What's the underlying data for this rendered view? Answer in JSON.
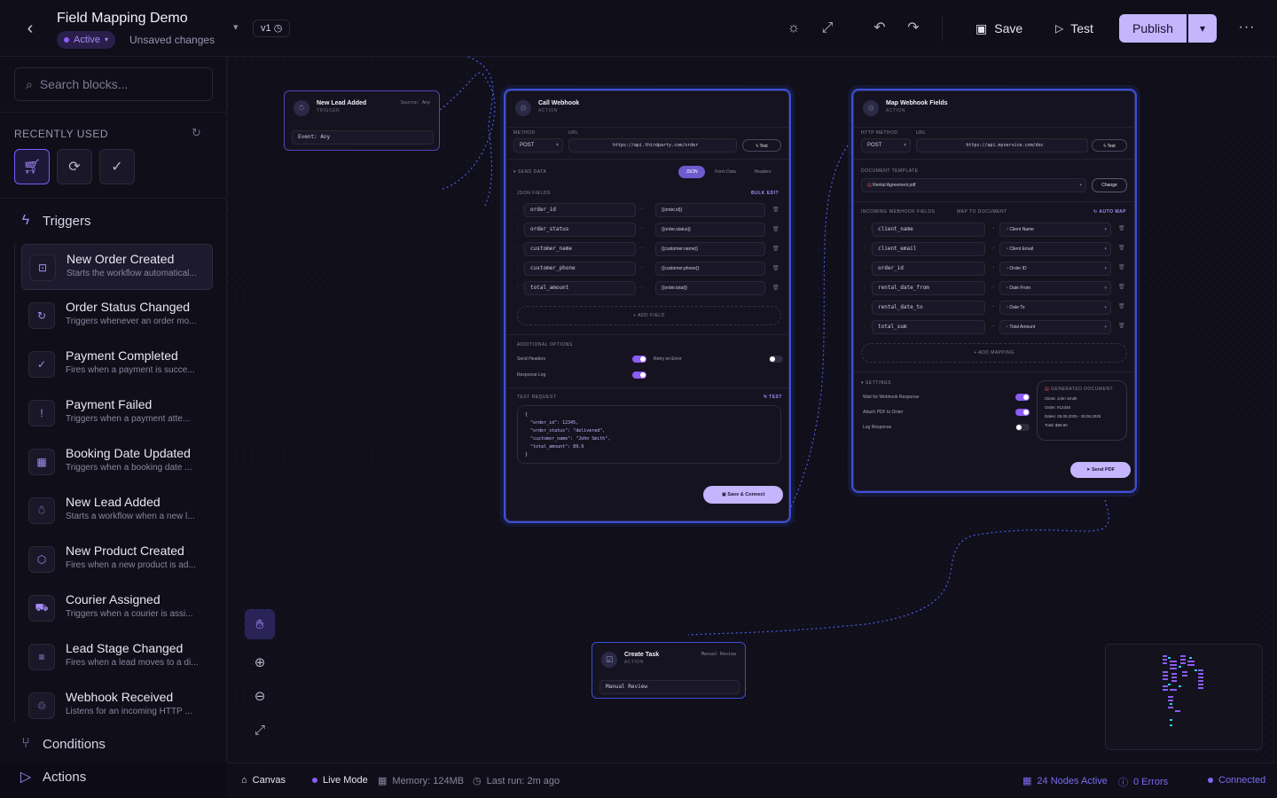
{
  "header": {
    "title": "Field Mapping Demo",
    "status": "Active",
    "unsaved": "Unsaved changes",
    "version": "v1",
    "save_label": "Save",
    "test_label": "Test",
    "publish_label": "Publish"
  },
  "sidebar": {
    "search_placeholder": "Search blocks...",
    "recently_used_title": "RECENTLY USED",
    "sections": {
      "triggers": "Triggers",
      "conditions": "Conditions",
      "actions": "Actions"
    },
    "triggers": [
      {
        "title": "New Order Created",
        "desc": "Starts the workflow automatical..."
      },
      {
        "title": "Order Status Changed",
        "desc": "Triggers whenever an order mo..."
      },
      {
        "title": "Payment Completed",
        "desc": "Fires when a payment is succe..."
      },
      {
        "title": "Payment Failed",
        "desc": "Triggers when a payment atte..."
      },
      {
        "title": "Booking Date Updated",
        "desc": "Triggers when a booking date ..."
      },
      {
        "title": "New Lead Added",
        "desc": "Starts a workflow when a new l..."
      },
      {
        "title": "New Product Created",
        "desc": "Fires when a new product is ad..."
      },
      {
        "title": "Courier Assigned",
        "desc": "Triggers when a courier is assi..."
      },
      {
        "title": "Lead Stage Changed",
        "desc": "Fires when a lead moves to a di..."
      },
      {
        "title": "Webhook Received",
        "desc": "Listens for an incoming HTTP ..."
      }
    ]
  },
  "nodes": {
    "lead": {
      "title": "New Lead Added",
      "type": "TRIGGER",
      "source": "Source: Any",
      "event": "Event: Any"
    },
    "webhook": {
      "title": "Call Webhook",
      "type": "ACTION",
      "method_label": "METHOD",
      "url_label": "URL",
      "method": "POST",
      "url": "https://api.thirdparty.com/order",
      "test": "Test",
      "send_data": "SEND DATA",
      "tabs": [
        "JSON",
        "Form Data",
        "Headers"
      ],
      "json_fields_label": "JSON FIELDS",
      "bulk_edit": "BULK EDIT",
      "fields": [
        {
          "key": "order_id",
          "value": "{{order.id}}"
        },
        {
          "key": "order_status",
          "value": "{{order.status}}"
        },
        {
          "key": "customer_name",
          "value": "{{customer.name}}"
        },
        {
          "key": "customer_phone",
          "value": "{{customer.phone}}"
        },
        {
          "key": "total_amount",
          "value": "{{order.total}}"
        }
      ],
      "add_field": "ADD FIELD",
      "additional_options": "ADDITIONAL OPTIONS",
      "send_headers": "Send Headers",
      "retry_on_error": "Retry on Error",
      "response_log": "Response Log",
      "test_request": "TEST REQUEST",
      "test_small": "TEST",
      "json_preview": [
        "{",
        "  \"order_id\": 12345,",
        "  \"order_status\": \"delivered\",",
        "  \"customer_name\": \"John Smith\",",
        "  \"total_amount\": 89.9",
        "}"
      ],
      "save_connect": "Save & Connect"
    },
    "map": {
      "title": "Map Webhook Fields",
      "type": "ACTION",
      "method_label": "HTTP METHOD",
      "url_label": "URL",
      "method": "POST",
      "url": "https://api.myservice.com/doc",
      "test": "Test",
      "doc_template_label": "DOCUMENT TEMPLATE",
      "doc_template": "Rental Agreement.pdf",
      "change": "Change",
      "incoming_label": "INCOMING WEBHOOK FIELDS",
      "map_to_label": "MAP TO DOCUMENT",
      "auto_map": "AUTO MAP",
      "mappings": [
        {
          "from": "client_name",
          "to": "Client Name"
        },
        {
          "from": "client_email",
          "to": "Client Email"
        },
        {
          "from": "order_id",
          "to": "Order ID"
        },
        {
          "from": "rental_date_from",
          "to": "Date From"
        },
        {
          "from": "rental_date_to",
          "to": "Date To"
        },
        {
          "from": "total_sum",
          "to": "Total Amount"
        }
      ],
      "add_mapping": "ADD MAPPING",
      "settings": "SETTINGS",
      "wait_response": "Wait for Webhook Response",
      "attach_pdf": "Attach PDF to Order",
      "log_response": "Log Response",
      "gen_doc_label": "GENERATED DOCUMENT",
      "gen_client": "Client: John Smith",
      "gen_order": "Order: #12345",
      "gen_dates": "Dates: 25.05.2025 - 28.05.2025",
      "gen_total": "Total: $89.90",
      "send_pdf": "Send PDF"
    },
    "task": {
      "title": "Create Task",
      "type": "ACTION",
      "right": "Manual Review",
      "value": "Manual Review"
    }
  },
  "footer": {
    "canvas": "Canvas",
    "live_mode": "Live Mode",
    "memory": "Memory: 124MB",
    "last_run": "Last run: 2m ago",
    "nodes_active": "24 Nodes Active",
    "errors": "0 Errors",
    "connected": "Connected"
  },
  "colors": {
    "accent": "#8b5cf6",
    "accent_light": "#c4b5fd",
    "selection": "#3b4fd8",
    "background": "#100f1a"
  }
}
